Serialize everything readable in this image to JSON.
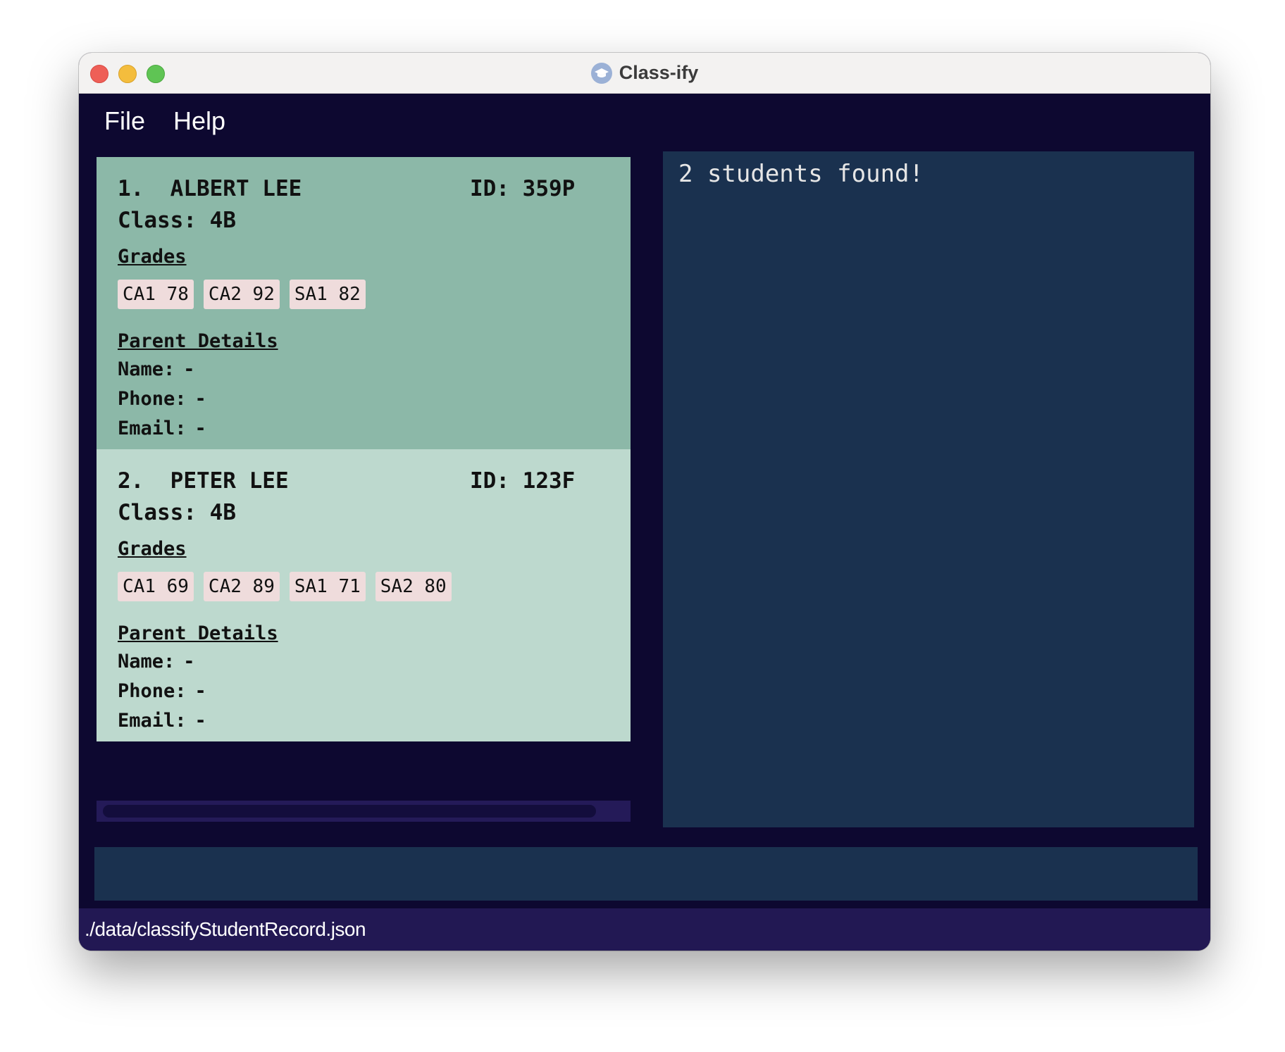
{
  "window": {
    "title": "Class-ify",
    "app_icon": "graduation-cap-icon"
  },
  "menu": {
    "file": "File",
    "help": "Help"
  },
  "labels": {
    "id": "ID:",
    "class": "Class:",
    "grades": "Grades",
    "parent_details": "Parent Details",
    "name": "Name:",
    "phone": "Phone:",
    "email": "Email:"
  },
  "students": [
    {
      "index_name": "1.  ALBERT LEE",
      "id": "359P",
      "class": "4B",
      "grades": [
        "CA1 78",
        "CA2 92",
        "SA1 82"
      ],
      "parent": {
        "name": "-",
        "phone": "-",
        "email": "-"
      },
      "selected": true
    },
    {
      "index_name": "2.  PETER LEE",
      "id": "123F",
      "class": "4B",
      "grades": [
        "CA1 69",
        "CA2 89",
        "SA1 71",
        "SA2 80"
      ],
      "parent": {
        "name": "-",
        "phone": "-",
        "email": "-"
      },
      "selected": false
    }
  ],
  "result": {
    "message": "2 students found!"
  },
  "command": {
    "value": ""
  },
  "status": {
    "file_path": "./data/classifyStudentRecord.json"
  },
  "colors": {
    "background": "#0d0830",
    "selected_card": "#8cb8a8",
    "card": "#bdd9ce",
    "grade_chip": "#efdcdc",
    "result_panel": "#1a314f",
    "statusbar": "#221853"
  }
}
